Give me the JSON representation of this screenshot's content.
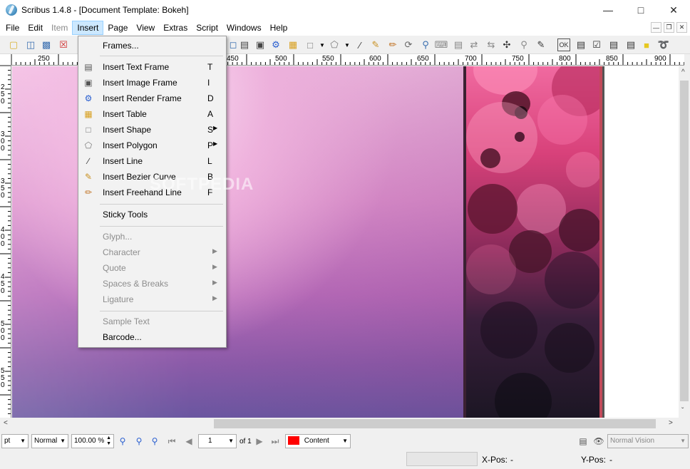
{
  "window": {
    "title": "Scribus 1.4.8 - [Document Template: Bokeh]"
  },
  "menubar": {
    "items": [
      {
        "label": "File",
        "disabled": false
      },
      {
        "label": "Edit",
        "disabled": false
      },
      {
        "label": "Item",
        "disabled": true
      },
      {
        "label": "Insert",
        "disabled": false,
        "active": true
      },
      {
        "label": "Page",
        "disabled": false
      },
      {
        "label": "View",
        "disabled": false
      },
      {
        "label": "Extras",
        "disabled": false
      },
      {
        "label": "Script",
        "disabled": false
      },
      {
        "label": "Windows",
        "disabled": false
      },
      {
        "label": "Help",
        "disabled": false
      }
    ]
  },
  "insert_menu": {
    "frames": "Frames...",
    "insert_text_frame": {
      "label": "Insert Text Frame",
      "shortcut": "T"
    },
    "insert_image_frame": {
      "label": "Insert Image Frame",
      "shortcut": "I"
    },
    "insert_render_frame": {
      "label": "Insert Render Frame",
      "shortcut": "D"
    },
    "insert_table": {
      "label": "Insert Table",
      "shortcut": "A"
    },
    "insert_shape": {
      "label": "Insert Shape",
      "shortcut": "S"
    },
    "insert_polygon": {
      "label": "Insert Polygon",
      "shortcut": "P"
    },
    "insert_line": {
      "label": "Insert Line",
      "shortcut": "L"
    },
    "insert_bezier": {
      "label": "Insert Bezier Curve",
      "shortcut": "B"
    },
    "insert_freehand": {
      "label": "Insert Freehand Line",
      "shortcut": "F"
    },
    "sticky_tools": "Sticky Tools",
    "glyph": "Glyph...",
    "character": "Character",
    "quote": "Quote",
    "spaces_breaks": "Spaces & Breaks",
    "ligature": "Ligature",
    "sample_text": "Sample Text",
    "barcode": "Barcode..."
  },
  "ruler": {
    "top_labels": [
      "250",
      "450",
      "500",
      "550",
      "600",
      "650",
      "700",
      "750",
      "800",
      "850",
      "900"
    ],
    "left_labels": [
      "2 5 0",
      "3 0 0",
      "3 5 0",
      "4 0 0",
      "4 5 0",
      "5 0 0",
      "5 5 0"
    ]
  },
  "statusbar": {
    "unit": "pt",
    "mode": "Normal",
    "zoom": "100.00 %",
    "page": "1",
    "page_of": "of 1",
    "layer": "Content",
    "layer_color": "#ff0000",
    "vision": "Normal Vision",
    "x_label": "X-Pos:",
    "x_value": "-",
    "y_label": "Y-Pos:",
    "y_value": "-"
  },
  "watermark": "SOFTPEDIA"
}
